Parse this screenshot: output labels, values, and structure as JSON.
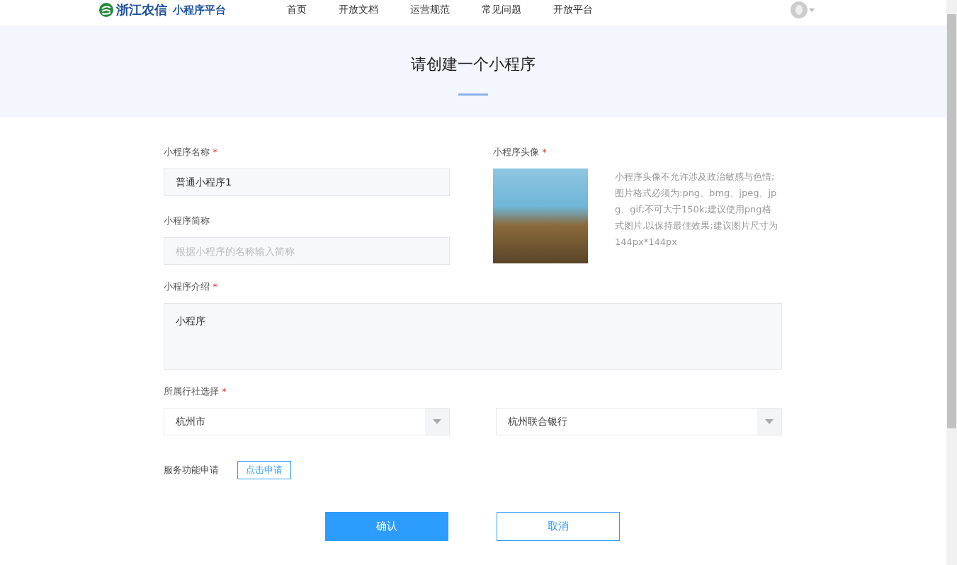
{
  "header": {
    "logo_brand": "浙江农信",
    "logo_product": "小程序平台",
    "nav": [
      {
        "label": "首页",
        "selected": false
      },
      {
        "label": "开放文档",
        "selected": false
      },
      {
        "label": "运营规范",
        "selected": false
      },
      {
        "label": "常见问题",
        "selected": false
      },
      {
        "label": "开放平台",
        "selected": false
      }
    ]
  },
  "banner": {
    "title": "请创建一个小程序"
  },
  "form": {
    "name": {
      "label": "小程序名称",
      "mark": "*",
      "value": "普通小程序1"
    },
    "short_name": {
      "label": "小程序简称",
      "placeholder": "根据小程序的名称输入简称"
    },
    "avatar": {
      "label": "小程序头像",
      "mark": "*",
      "hint": "小程序头像不允许涉及政治敏感与色情;图片格式必须为:png、bmg、jpeg、jpg、gif;不可大于150k;建议使用png格式图片,以保持最佳效果;建议图片尺寸为144px*144px"
    },
    "intro": {
      "label": "小程序介绍",
      "mark": "*",
      "value": "小程序"
    },
    "branch": {
      "label": "所属行社选择",
      "mark": "*",
      "selects": [
        "杭州市",
        "杭州联合银行"
      ]
    },
    "service": {
      "label": "服务功能申请",
      "button": "点击申请"
    },
    "buttons": {
      "confirm": "确认",
      "cancel": "取消"
    }
  }
}
